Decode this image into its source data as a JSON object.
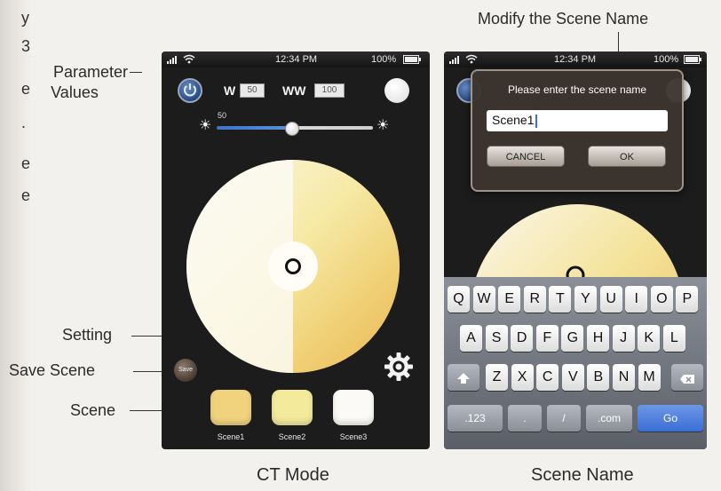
{
  "page_edge_letters": [
    "y",
    "3",
    "e",
    ".",
    "e",
    "e"
  ],
  "callouts": {
    "parameter_values_1": "Parameter",
    "parameter_values_2": "Values",
    "setting": "Setting",
    "save_scene": "Save Scene",
    "scene": "Scene",
    "modify_scene_name": "Modify the Scene Name"
  },
  "captions": {
    "left": "CT Mode",
    "right": "Scene Name"
  },
  "status": {
    "time": "12:34 PM",
    "battery": "100%"
  },
  "ct_mode": {
    "w_label": "W",
    "w_value": "50",
    "ww_label": "WW",
    "ww_value": "100",
    "slider_value": "50",
    "slider_level_percent": 48,
    "save_label": "Save",
    "scenes": [
      {
        "label": "Scene1",
        "color": "#f1d37e"
      },
      {
        "label": "Scene2",
        "color": "#f3ea9c"
      },
      {
        "label": "Scene3",
        "color": "#fbfaf6"
      }
    ]
  },
  "scene_name": {
    "prompt": "Please enter the scene name",
    "input_value": "Scene1",
    "cancel_label": "CANCEL",
    "ok_label": "OK",
    "keyboard": {
      "row1": [
        "Q",
        "W",
        "E",
        "R",
        "T",
        "Y",
        "U",
        "I",
        "O",
        "P"
      ],
      "row2": [
        "A",
        "S",
        "D",
        "F",
        "G",
        "H",
        "J",
        "K",
        "L"
      ],
      "row3": [
        "Z",
        "X",
        "C",
        "V",
        "B",
        "N",
        "M"
      ],
      "row4": [
        ".123",
        ".",
        "/",
        ".com",
        "Go"
      ]
    }
  },
  "colors": {
    "wheel_warm": "#e9b653",
    "wheel_mid": "#f3dc8a",
    "wheel_cool": "#fbf8ec",
    "accent_blue": "#3b6fd6"
  }
}
